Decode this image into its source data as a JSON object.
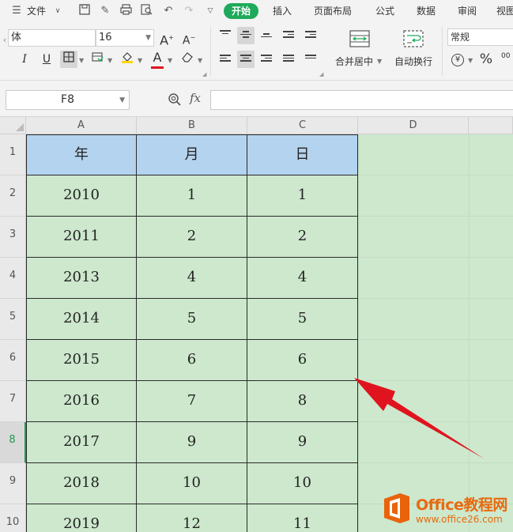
{
  "menubar": {
    "file_label": "文件",
    "tabs": [
      "开始",
      "插入",
      "页面布局",
      "公式",
      "数据",
      "审阅",
      "视图"
    ],
    "active_tab": "开始"
  },
  "ribbon": {
    "font_name": "体",
    "font_size": "16",
    "merge_label": "合并居中",
    "wrap_label": "自动换行",
    "number_format": "常规",
    "font_grow": "A",
    "font_shrink": "A",
    "italic": "I",
    "underline": "U",
    "font_color_letter": "A",
    "percent": "%",
    "decimal_hint": "00"
  },
  "formula_bar": {
    "name_box": "F8",
    "fx_label": "fx",
    "formula": ""
  },
  "sheet": {
    "columns": [
      "A",
      "B",
      "C",
      "D"
    ],
    "row_numbers": [
      "1",
      "2",
      "3",
      "4",
      "5",
      "6",
      "7",
      "8",
      "9",
      "10"
    ],
    "selected_row": "8",
    "header_row": [
      "年",
      "月",
      "日"
    ],
    "rows": [
      [
        "2010",
        "1",
        "1"
      ],
      [
        "2011",
        "2",
        "2"
      ],
      [
        "2013",
        "4",
        "4"
      ],
      [
        "2014",
        "5",
        "5"
      ],
      [
        "2015",
        "6",
        "6"
      ],
      [
        "2016",
        "7",
        "8"
      ],
      [
        "2017",
        "9",
        "9"
      ],
      [
        "2018",
        "10",
        "10"
      ],
      [
        "2019",
        "12",
        "11"
      ]
    ]
  },
  "watermark": {
    "title": "Office教程网",
    "url": "www.office26.com"
  },
  "colors": {
    "accent_green": "#1eaa5a",
    "header_fill": "#b4d3ee",
    "sheet_background": "#cde8cd",
    "arrow_red": "#e0141e",
    "watermark_orange": "#e86a10"
  }
}
